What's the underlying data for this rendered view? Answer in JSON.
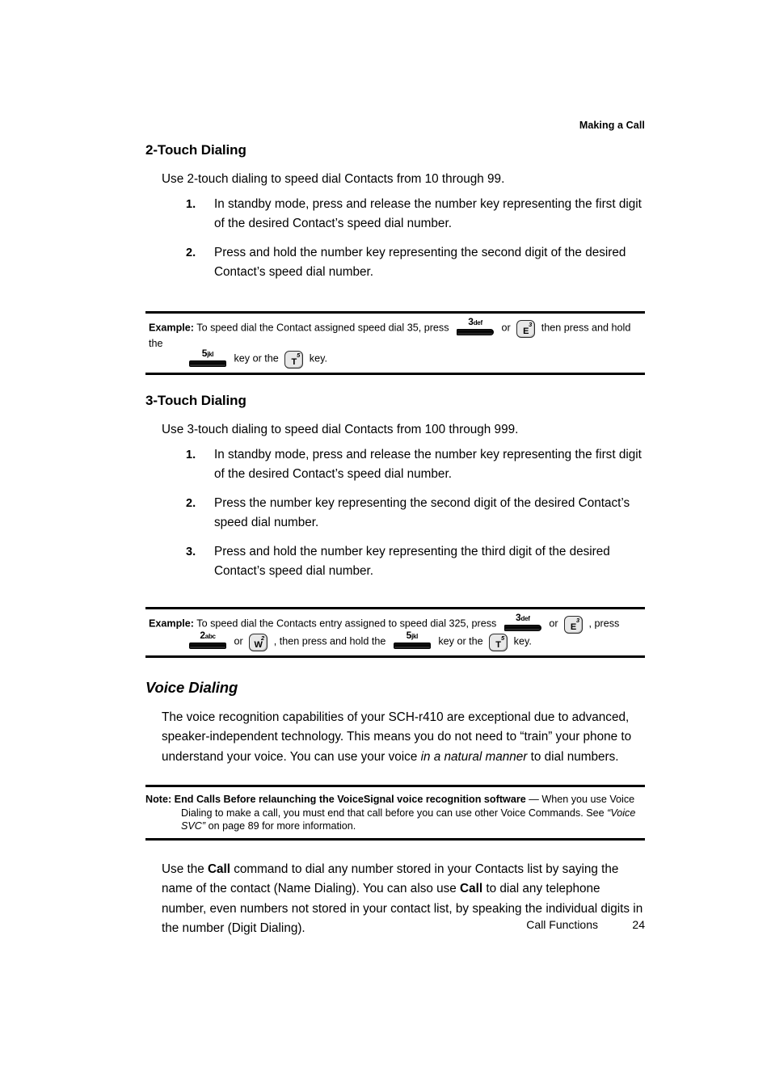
{
  "header": {
    "running_head": "Making a Call"
  },
  "sections": {
    "two_touch": {
      "title": "2-Touch Dialing",
      "intro": "Use 2-touch dialing to speed dial Contacts from 10 through 99.",
      "steps": [
        {
          "num": "1.",
          "text": "In standby mode, press and release the number key representing the first digit of the desired Contact’s speed dial number."
        },
        {
          "num": "2.",
          "text": "Press and hold the number key representing the second digit of the desired Contact’s speed dial number."
        }
      ]
    },
    "three_touch": {
      "title": "3-Touch Dialing",
      "intro": "Use 3-touch dialing to speed dial Contacts from 100 through 999.",
      "steps": [
        {
          "num": "1.",
          "text": "In standby mode, press and release the number key representing the first digit of the desired Contact’s speed dial number."
        },
        {
          "num": "2.",
          "text": "Press the number key representing the second digit of the desired Contact’s speed dial number."
        },
        {
          "num": "3.",
          "text": "Press and hold the number key representing the third digit of the desired Contact’s speed dial number."
        }
      ]
    },
    "voice_dialing": {
      "title": "Voice Dialing",
      "paragraph_1_a": "The voice recognition capabilities of your SCH-r410 are exceptional due to advanced, speaker-independent technology. This means you do not need to “train” your phone to understand your voice. You can use your voice ",
      "paragraph_1_italic": "in a natural manner",
      "paragraph_1_b": " to dial numbers.",
      "paragraph_2": {
        "a": "Use the ",
        "bold_1": "Call",
        "b": " command to dial any number stored in your Contacts list by saying the name of the contact (Name Dialing). You can also use ",
        "bold_2": "Call",
        "c": " to dial any telephone number, even numbers not stored in your contact list, by speaking the individual digits in the number (Digit Dialing)."
      }
    }
  },
  "example_1": {
    "lead": "Example:",
    "t1": " To speed dial the Contact assigned speed dial 35, press ",
    "t2": " or ",
    "t3": " then press and hold the ",
    "t4": " key or the ",
    "t5": " key.",
    "keys": {
      "k3_digit": "3",
      "k3_letters": "def",
      "ke_letter": "E",
      "ke_sup": "3",
      "k5_digit": "5",
      "k5_letters": "jkl",
      "kt_letter": "T",
      "kt_sup": "5"
    }
  },
  "example_2": {
    "lead": "Example:",
    "t1": " To speed dial the Contacts entry assigned to speed dial 325, press ",
    "t2": " or ",
    "t3": " , press ",
    "t4": " or ",
    "t5": " , then press and hold the ",
    "t6": " key or the ",
    "t7": " key.",
    "keys": {
      "k3_digit": "3",
      "k3_letters": "def",
      "ke_letter": "E",
      "ke_sup": "3",
      "k2_digit": "2",
      "k2_letters": "abc",
      "kw_letter": "W",
      "kw_sup": "2",
      "k5_digit": "5",
      "k5_letters": "jkl",
      "kt_letter": "T",
      "kt_sup": "5"
    }
  },
  "note": {
    "lead": "Note: End Calls Before relaunching the VoiceSignal voice recognition software",
    "dash": " — When you use Voice Dialing to make a call, you must end that call before you can use other Voice Commands. See ",
    "ref_italic": "“Voice SVC”",
    "tail": " on page 89 for more information."
  },
  "footer": {
    "chapter": "Call Functions",
    "page_number": "24"
  }
}
